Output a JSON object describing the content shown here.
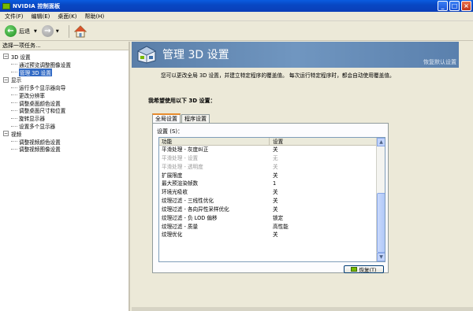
{
  "window": {
    "title": "NVIDIA 控制面板",
    "buttons": [
      "minimize",
      "maximize",
      "close"
    ]
  },
  "menubar": [
    "文件(F)",
    "编辑(E)",
    "桌面(K)",
    "帮助(H)"
  ],
  "toolbar": {
    "back_label": "后退",
    "back_icon": "back-arrow-icon",
    "forward_icon": "forward-arrow-icon",
    "home_icon": "home-icon"
  },
  "sidebar": {
    "header": "选择一项任务...",
    "groups": [
      {
        "label": "3D 设置",
        "expanded": true,
        "items": [
          "通过预览调整图像设置",
          "管理 3D 设置"
        ]
      },
      {
        "label": "显示",
        "expanded": true,
        "items": [
          "运行多个显示器向导",
          "更改分辨率",
          "调整桌面颜色设置",
          "调整桌面尺寸和位置",
          "旋转显示器",
          "设置多个显示器"
        ]
      },
      {
        "label": "视频",
        "expanded": true,
        "items": [
          "调整视频颜色设置",
          "调整视频图像设置"
        ]
      }
    ],
    "selected": "管理 3D 设置"
  },
  "main": {
    "title": "管理 3D 设置",
    "restore_defaults": "恢复默认设置",
    "description": "您可以更改全局 3D 设置，并建立特定程序的覆盖值。 每次运行特定程序时，都会自动使用覆盖值。",
    "section_title": "我希望使用以下 3D 设置：",
    "tabs": [
      "全局设置",
      "程序设置"
    ],
    "active_tab": "全局设置",
    "settings_label": "设置 (S)：",
    "columns": [
      "功能",
      "设置"
    ],
    "rows": [
      {
        "feature": "平滑处理 - 灰度纠正",
        "value": "关",
        "disabled": false
      },
      {
        "feature": "平滑处理 - 设置",
        "value": "无",
        "disabled": true
      },
      {
        "feature": "平滑处理 - 透明度",
        "value": "关",
        "disabled": true
      },
      {
        "feature": "扩展限度",
        "value": "关",
        "disabled": false
      },
      {
        "feature": "最大预渲染帧数",
        "value": "1",
        "disabled": false
      },
      {
        "feature": "环境光吸收",
        "value": "关",
        "disabled": false
      },
      {
        "feature": "纹理过滤 - 三线性优化",
        "value": "关",
        "disabled": false
      },
      {
        "feature": "纹理过滤 - 各向异性采样优化",
        "value": "关",
        "disabled": false
      },
      {
        "feature": "纹理过滤 - 负 LOD 偏移",
        "value": "锁定",
        "disabled": false
      },
      {
        "feature": "纹理过滤 - 质量",
        "value": "高性能",
        "disabled": false
      },
      {
        "feature": "纹理优化",
        "value": "关",
        "disabled": false
      }
    ],
    "restore_button": "恢复(T)",
    "scrollbar_position": 0.6
  },
  "colors": {
    "titlebar": "#0a5ce0",
    "banner": "#6a8fb8",
    "selection": "#316ac5",
    "tab_accent": "#e68b2c"
  }
}
